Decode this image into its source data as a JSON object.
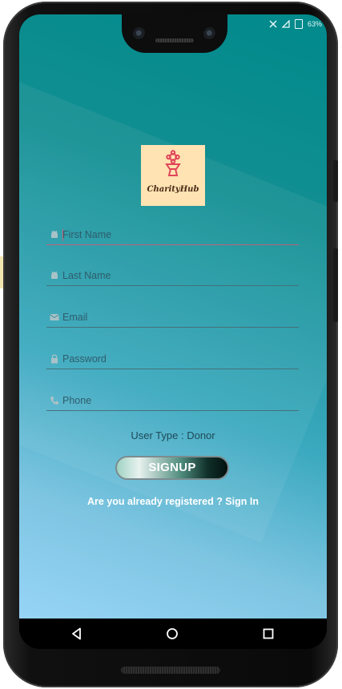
{
  "status": {
    "battery_text": "63%"
  },
  "logo": {
    "text": "CharityHub",
    "icon": "flower-trophy-icon"
  },
  "form": {
    "first_name": {
      "placeholder": "First Name",
      "icon": "android-icon"
    },
    "last_name": {
      "placeholder": "Last Name",
      "icon": "android-icon"
    },
    "email": {
      "placeholder": "Email",
      "icon": "mail-icon"
    },
    "password": {
      "placeholder": "Password",
      "icon": "lock-icon"
    },
    "phone": {
      "placeholder": "Phone",
      "icon": "phone-icon"
    }
  },
  "user_type_label": "User Type : Donor",
  "signup_label": "SIGNUP",
  "signin_link_text": "Are you already registered ? Sign In",
  "navbar": {
    "back_icon": "back-triangle-icon",
    "home_icon": "home-circle-icon",
    "recents_icon": "recents-square-icon"
  },
  "colors": {
    "accent_line": "#c0607a",
    "app_bg_top": "#00898b",
    "app_bg_bottom": "#97d4f6",
    "logo_bg": "#ffe3b2"
  }
}
